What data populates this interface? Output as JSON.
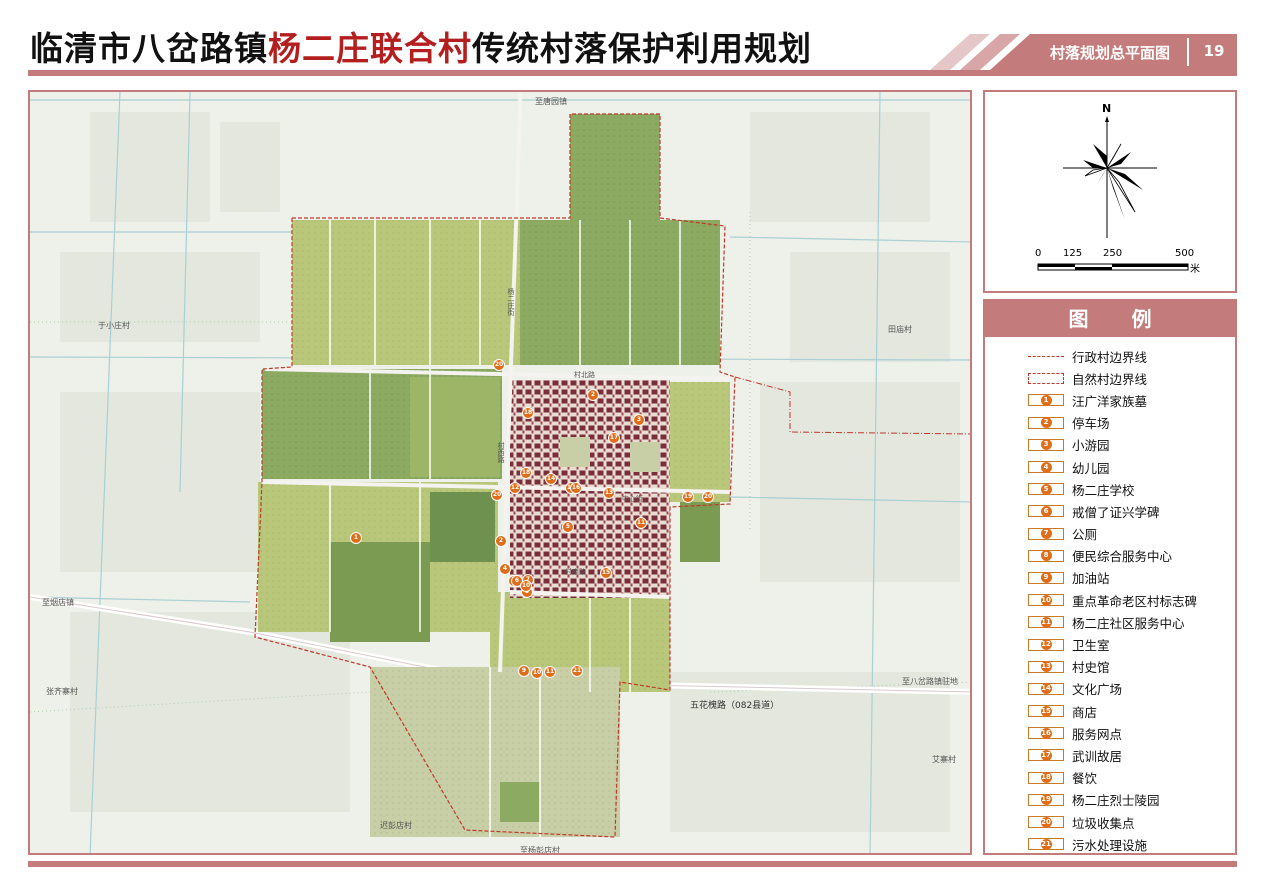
{
  "header": {
    "title_prefix": "临清市八岔路镇",
    "title_highlight": "杨二庄联合村",
    "title_suffix": "传统村落保护利用规划",
    "sheet_name": "村落规划总平面图",
    "page_number": "19"
  },
  "colors": {
    "accent": "#c47b7b",
    "title_highlight": "#b51e1e",
    "poi_marker": "#e06d1a",
    "boundary": "#c0392b"
  },
  "compass": {
    "north_label": "N",
    "scale_ticks": [
      "0",
      "125",
      "250",
      "500"
    ],
    "scale_unit": "米"
  },
  "legend": {
    "title": "图  例",
    "items": [
      {
        "type": "line-dashdot",
        "label": "行政村边界线"
      },
      {
        "type": "line-dashed-box",
        "label": "自然村边界线"
      },
      {
        "type": "poi",
        "num": "1",
        "label": "汪广洋家族墓"
      },
      {
        "type": "poi",
        "num": "2",
        "label": "停车场"
      },
      {
        "type": "poi",
        "num": "3",
        "label": "小游园"
      },
      {
        "type": "poi",
        "num": "4",
        "label": "幼儿园"
      },
      {
        "type": "poi",
        "num": "5",
        "label": "杨二庄学校"
      },
      {
        "type": "poi",
        "num": "6",
        "label": "戒僧了证兴学碑"
      },
      {
        "type": "poi",
        "num": "7",
        "label": "公厕"
      },
      {
        "type": "poi",
        "num": "8",
        "label": "便民综合服务中心"
      },
      {
        "type": "poi",
        "num": "9",
        "label": "加油站"
      },
      {
        "type": "poi",
        "num": "10",
        "label": "重点革命老区村标志碑"
      },
      {
        "type": "poi",
        "num": "11",
        "label": "杨二庄社区服务中心"
      },
      {
        "type": "poi",
        "num": "12",
        "label": "卫生室"
      },
      {
        "type": "poi",
        "num": "13",
        "label": "村史馆"
      },
      {
        "type": "poi",
        "num": "14",
        "label": "文化广场"
      },
      {
        "type": "poi",
        "num": "15",
        "label": "商店"
      },
      {
        "type": "poi",
        "num": "16",
        "label": "服务网点"
      },
      {
        "type": "poi",
        "num": "17",
        "label": "武训故居"
      },
      {
        "type": "poi",
        "num": "18",
        "label": "餐饮"
      },
      {
        "type": "poi",
        "num": "19",
        "label": "杨二庄烈士陵园"
      },
      {
        "type": "poi",
        "num": "20",
        "label": "垃圾收集点"
      },
      {
        "type": "poi",
        "num": "21",
        "label": "污水处理设施"
      }
    ]
  },
  "map": {
    "labels": {
      "to_tangyuan": "至唐园镇",
      "yuxiaozhuang": "于小庄村",
      "tianmiao": "田庙村",
      "to_yandian": "至烟店镇",
      "zhangqizhai": "张齐寨村",
      "to_bachalu": "至八岔路镇驻地",
      "wuhuahuai_road": "五花槐路（082县道）",
      "aizhai": "艾寨村",
      "chipengdian": "迟彭店村",
      "to_yangpengdian": "至杨彭店村",
      "cunbei_road": "村北路",
      "yangerzhuang_street": "杨二庄街",
      "cunxi_road": "村西路",
      "zhongxin_street": "中心街",
      "nan_road": "村南路"
    },
    "pois": [
      {
        "num": "1"
      },
      {
        "num": "2"
      },
      {
        "num": "2"
      },
      {
        "num": "3"
      },
      {
        "num": "3"
      },
      {
        "num": "4"
      },
      {
        "num": "5"
      },
      {
        "num": "6"
      },
      {
        "num": "7"
      },
      {
        "num": "8"
      },
      {
        "num": "9"
      },
      {
        "num": "10"
      },
      {
        "num": "11"
      },
      {
        "num": "12"
      },
      {
        "num": "13"
      },
      {
        "num": "13"
      },
      {
        "num": "14"
      },
      {
        "num": "15"
      },
      {
        "num": "16"
      },
      {
        "num": "17"
      },
      {
        "num": "18"
      },
      {
        "num": "18"
      },
      {
        "num": "19"
      },
      {
        "num": "20"
      },
      {
        "num": "20"
      },
      {
        "num": "20"
      },
      {
        "num": "21"
      },
      {
        "num": "10"
      },
      {
        "num": "11"
      }
    ]
  }
}
